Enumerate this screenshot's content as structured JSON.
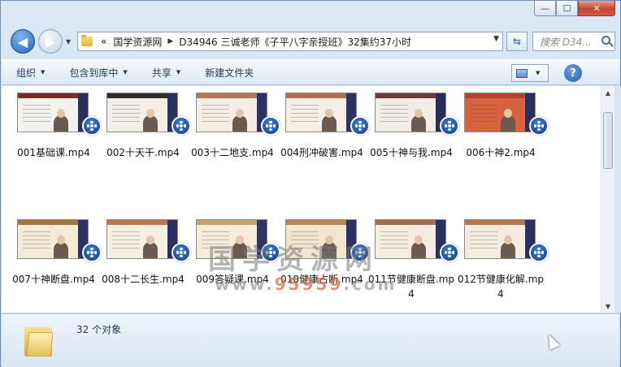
{
  "window": {
    "caption": {
      "minimize": "—",
      "maximize": "☐",
      "close": "✕"
    }
  },
  "nav": {
    "back_glyph": "◀",
    "forward_glyph": "▶",
    "breadcrumb_prefix": "«",
    "breadcrumbs": [
      "国学资源网",
      "D34946 三诚老师《子平八字亲授班》32集约37小时"
    ],
    "search_placeholder": "搜索 D34...",
    "refresh_glyph": "⇆"
  },
  "toolbar": {
    "organize": "组织",
    "include_in_library": "包含到库中",
    "share": "共享",
    "new_folder": "新建文件夹",
    "help": "?"
  },
  "files": [
    {
      "name": "001基础课.mp4",
      "top": "#7a2c23",
      "body": "#f3f2ef",
      "side": "#2b2f5a"
    },
    {
      "name": "002十天干.mp4",
      "top": "#2f2f2f",
      "body": "#f4efe6",
      "side": "#2c3260"
    },
    {
      "name": "003十二地支.mp4",
      "top": "#b07a55",
      "body": "#f5ede2",
      "side": "#2a3165"
    },
    {
      "name": "004刑冲破害.mp4",
      "top": "#b56f46",
      "body": "#f6efe5",
      "side": "#2d345f"
    },
    {
      "name": "005十神与我.mp4",
      "top": "#6e3b35",
      "body": "#f2ede6",
      "side": "#262d5c"
    },
    {
      "name": "006十神2.mp4",
      "top": "#b3452e",
      "body": "#d7623f",
      "side": "#2b2f5f"
    },
    {
      "name": "007十神断盘.mp4",
      "top": "#a77340",
      "body": "#f3ead8",
      "side": "#2c3362"
    },
    {
      "name": "008十二长生.mp4",
      "top": "#b97850",
      "body": "#f6efe4",
      "side": "#2a3061"
    },
    {
      "name": "009答疑课.mp4",
      "top": "#c8a06b",
      "body": "#f5ecd9",
      "side": "#2e3564"
    },
    {
      "name": "010健康占断.mp4",
      "top": "#b9865a",
      "body": "#f3e6ce",
      "side": "#2b3262"
    },
    {
      "name": "011节健康断盘.mp4",
      "top": "#a06f4a",
      "body": "#f5ede1",
      "side": "#2a3060"
    },
    {
      "name": "012节健康化解.mp4",
      "top": "#b3784c",
      "body": "#f4ecdf",
      "side": "#2b3162"
    }
  ],
  "watermark": {
    "line1": "国学资源网",
    "line2_prefix": "www.",
    "line2_number": "95959",
    "line2_suffix": ".com"
  },
  "status": {
    "count_text": "32 个对象"
  }
}
